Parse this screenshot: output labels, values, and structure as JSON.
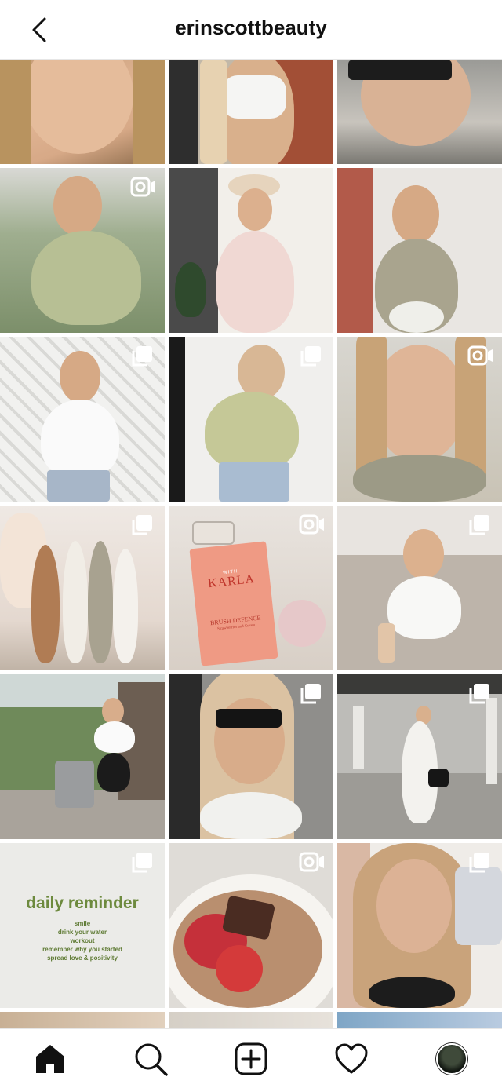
{
  "header": {
    "title": "erinscottbeauty",
    "back_icon": "chevron-left-icon"
  },
  "reminder": {
    "title": "daily reminder",
    "lines": [
      "smile",
      "drink your water",
      "workout",
      "remember why you started",
      "spread love & positivity"
    ]
  },
  "product": {
    "brand_small": "WITH",
    "brand": "KARLA",
    "name": "BRUSH DEFENCE",
    "subtitle": "Strawberries and Cream"
  },
  "badges": {
    "multi_photo": "carousel-icon",
    "video": "video-camera-icon"
  },
  "tabbar": {
    "items": [
      "home-icon",
      "search-icon",
      "new-post-icon",
      "activity-heart-icon",
      "profile-avatar"
    ]
  },
  "colors": {
    "text": "#111111",
    "reminder_green": "#6d8a3e",
    "divider": "#e6e6e6"
  }
}
